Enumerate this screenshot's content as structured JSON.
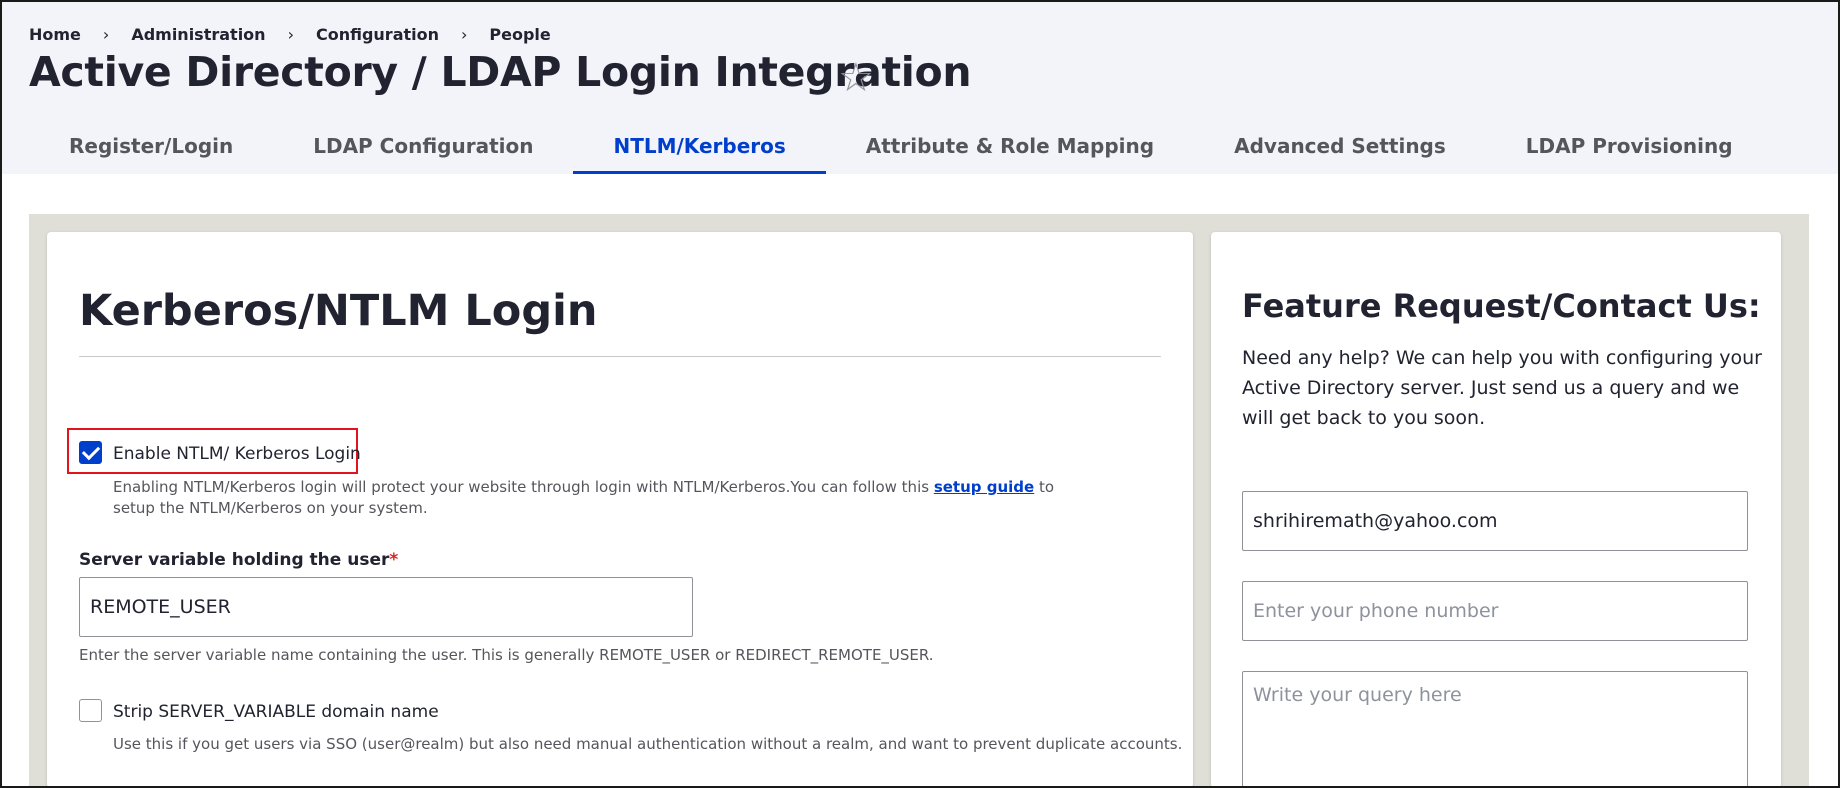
{
  "breadcrumb": {
    "items": [
      "Home",
      "Administration",
      "Configuration",
      "People"
    ],
    "separator": "›"
  },
  "page": {
    "title": "Active Directory / LDAP Login Integration",
    "star": "☆"
  },
  "tabs": [
    {
      "label": "Register/Login",
      "active": false
    },
    {
      "label": "LDAP Configuration",
      "active": false
    },
    {
      "label": "NTLM/Kerberos",
      "active": true
    },
    {
      "label": "Attribute & Role Mapping",
      "active": false
    },
    {
      "label": "Advanced Settings",
      "active": false
    },
    {
      "label": "LDAP Provisioning",
      "active": false
    }
  ],
  "main": {
    "section_title": "Kerberos/NTLM Login",
    "enable_checkbox": {
      "label": "Enable NTLM/ Kerberos Login",
      "checked": true,
      "desc_before": "Enabling NTLM/Kerberos login will protect your website through login with NTLM/Kerberos.You can follow this ",
      "link": "setup guide",
      "desc_after": " to setup the NTLM/Kerberos on your system."
    },
    "server_variable": {
      "label": "Server variable holding the user",
      "required_mark": "*",
      "value": "REMOTE_USER",
      "help": "Enter the server variable name containing the user. This is generally REMOTE_USER or REDIRECT_REMOTE_USER."
    },
    "strip_checkbox": {
      "label": "Strip SERVER_VARIABLE domain name",
      "checked": false,
      "desc": "Use this if you get users via SSO (user@realm) but also need manual authentication without a realm, and want to prevent duplicate accounts."
    }
  },
  "contact": {
    "title": "Feature Request/Contact Us:",
    "text": "Need any help? We can help you with configuring your Active Directory server. Just send us a query and we will get back to you soon.",
    "email_value": "shrihiremath@yahoo.com",
    "phone_placeholder": "Enter your phone number",
    "query_placeholder": "Write your query here"
  },
  "colors": {
    "accent": "#003ecc",
    "highlight_border": "#e3131b",
    "header_bg": "#f3f4f9",
    "content_bg": "#dfdfd8",
    "required": "#dc2323"
  }
}
